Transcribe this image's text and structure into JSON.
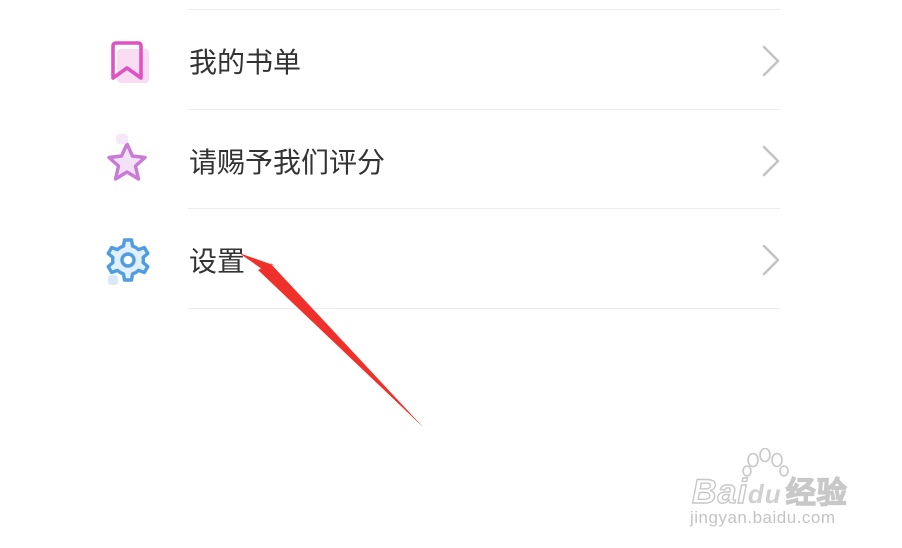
{
  "menu": {
    "items": [
      {
        "label": "我的书单",
        "icon": "bookmark-icon",
        "color": "#e052c4"
      },
      {
        "label": "请赐予我们评分",
        "icon": "star-icon",
        "color": "#c87ad6"
      },
      {
        "label": "设置",
        "icon": "gear-icon",
        "color": "#4f9de0"
      }
    ]
  },
  "annotation": {
    "arrow_color": "#f0302a",
    "target": "设置"
  },
  "watermark": {
    "brand_prefix": "Bai",
    "brand_du": "du",
    "brand_suffix": "经验",
    "url": "jingyan.baidu.com"
  }
}
